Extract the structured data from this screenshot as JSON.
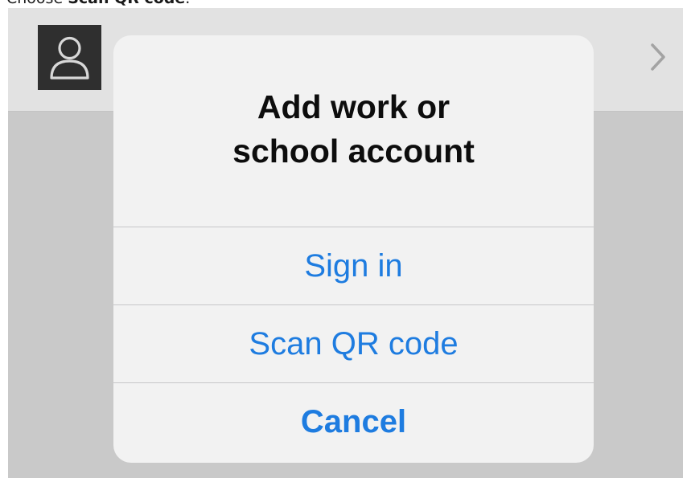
{
  "instruction": {
    "prefix": "Choose ",
    "emphasis": "Scan QR code",
    "suffix": "."
  },
  "background": {
    "avatar_icon": "person-icon",
    "chevron_icon": "chevron-right-icon"
  },
  "dialog": {
    "title_line1": "Add work or",
    "title_line2": "school account",
    "actions": [
      {
        "label": "Sign in"
      },
      {
        "label": "Scan QR code"
      },
      {
        "label": "Cancel"
      }
    ]
  },
  "colors": {
    "accent": "#1e7ce0",
    "dialog_bg": "#f2f2f2",
    "overlay": "#c9c9c9"
  }
}
